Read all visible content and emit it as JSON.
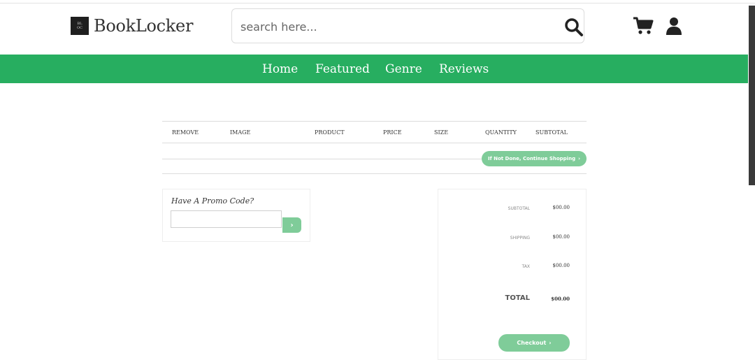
{
  "brand": {
    "name": "BookLocker",
    "mark": "BL OC"
  },
  "search": {
    "placeholder": "search here..."
  },
  "icons": {
    "search": "search-icon",
    "cart": "cart-icon",
    "user": "user-icon"
  },
  "nav": {
    "items": [
      "Home",
      "Featured",
      "Genre",
      "Reviews"
    ]
  },
  "colors": {
    "accent": "#27ae60",
    "button": "#7fcc99"
  },
  "cart_table": {
    "columns": [
      "REMOVE",
      "IMAGE",
      "PRODUCT",
      "PRICE",
      "SIZE",
      "QUANTITY",
      "SUBTOTAL"
    ],
    "continue_label": "If Not Done, Continue Shopping"
  },
  "promo": {
    "title": "Have A Promo Code?",
    "value": "",
    "submit_icon": "chevron-right-icon"
  },
  "totals": {
    "subtotal_label": "SUBTOTAL",
    "subtotal_value": "$00.00",
    "shipping_label": "SHIPPING",
    "shipping_value": "$00.00",
    "tax_label": "TAX",
    "tax_value": "$00.00",
    "total_label": "TOTAL",
    "total_value": "$00.00",
    "checkout_label": "Checkout"
  }
}
